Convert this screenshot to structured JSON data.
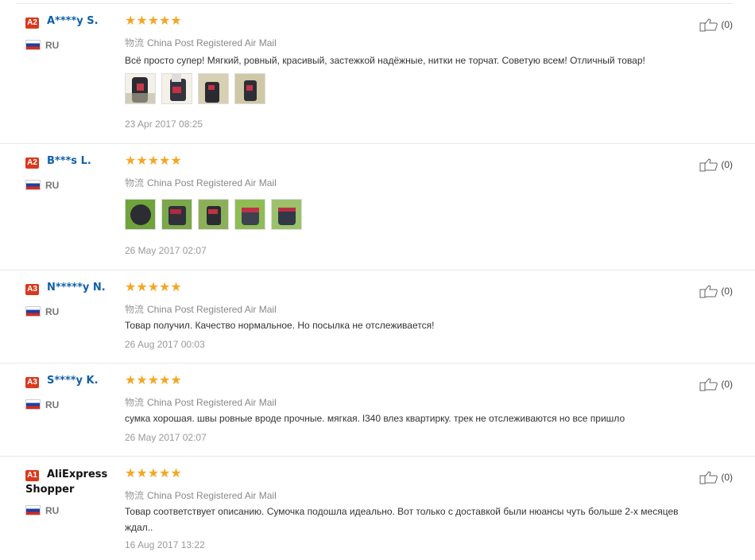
{
  "shipping_prefix": "物流",
  "reviews": [
    {
      "badge": "A2",
      "user": "A****y S.",
      "country": "RU",
      "stars": "★★★★★",
      "shipping": "China Post Registered Air Mail",
      "text": "Всё просто супер! Мягкий, ровный, красивый, застежкой надёжные, нитки не торчат. Советую всем! Отличный товар!",
      "photo_count": 4,
      "date": "23 Apr 2017 08:25",
      "helpful": "(0)"
    },
    {
      "badge": "A2",
      "user": "B***s L.",
      "country": "RU",
      "stars": "★★★★★",
      "shipping": "China Post Registered Air Mail",
      "text": "",
      "photo_count": 5,
      "date": "26 May 2017 02:07",
      "helpful": "(0)"
    },
    {
      "badge": "A3",
      "user": "N*****y N.",
      "country": "RU",
      "stars": "★★★★★",
      "shipping": "China Post Registered Air Mail",
      "text": "Товар получил. Качество нормальное. Но посылка не отслеживается!",
      "photo_count": 0,
      "date": "26 Aug 2017 00:03",
      "helpful": "(0)"
    },
    {
      "badge": "A3",
      "user": "S****y K.",
      "country": "RU",
      "stars": "★★★★★",
      "shipping": "China Post Registered Air Mail",
      "text": "сумка хорошая. швы ровные вроде прочные. мягкая. l340 влез квартирку. трек не отслеживаются но все пришло",
      "photo_count": 0,
      "date": "26 May 2017 02:07",
      "helpful": "(0)"
    },
    {
      "badge": "A1",
      "user": "AliExpress Shopper",
      "country": "RU",
      "stars": "★★★★★",
      "shipping": "China Post Registered Air Mail",
      "text": "Товар соответствует описанию. Сумочка подошла идеально. Вот только с доставкой были нюансы чуть больше 2-х месяцев ждал..",
      "photo_count": 0,
      "date": "16 Aug 2017 13:22",
      "helpful": "(0)"
    }
  ]
}
